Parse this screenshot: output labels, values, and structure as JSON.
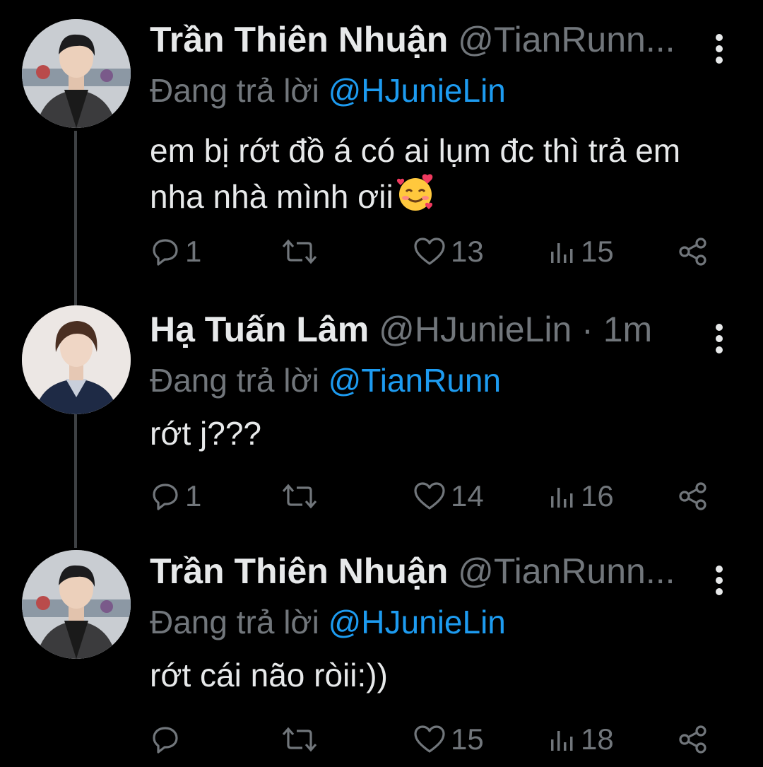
{
  "colors": {
    "background": "#000000",
    "text_primary": "#e7e9ea",
    "text_secondary": "#71767b",
    "accent": "#1d9bf0",
    "thread_line": "#3e4144"
  },
  "replying_prefix": "Đang trả lời",
  "tweets": [
    {
      "display_name": "Trần Thiên Nhuận",
      "handle": "@TianRunn...",
      "separator": "",
      "time": "",
      "reply_to": "@HJunieLin",
      "text": "em bị rớt đồ á có ai lụm đc thì trả em nha nhà mình ơii",
      "emoji": "smiling-face-with-hearts",
      "reply_count": "1",
      "retweet_count": "",
      "like_count": "13",
      "view_count": "15"
    },
    {
      "display_name": "Hạ Tuấn Lâm",
      "handle": "@HJunieLin",
      "separator": " · ",
      "time": "1m",
      "reply_to": "@TianRunn",
      "text": "rớt j???",
      "emoji": "",
      "reply_count": "1",
      "retweet_count": "",
      "like_count": "14",
      "view_count": "16"
    },
    {
      "display_name": "Trần Thiên Nhuận",
      "handle": "@TianRunn...",
      "separator": "",
      "time": "",
      "reply_to": "@HJunieLin",
      "text": "rớt cái não ròii:))",
      "emoji": "",
      "reply_count": "",
      "retweet_count": "",
      "like_count": "15",
      "view_count": "18"
    }
  ]
}
